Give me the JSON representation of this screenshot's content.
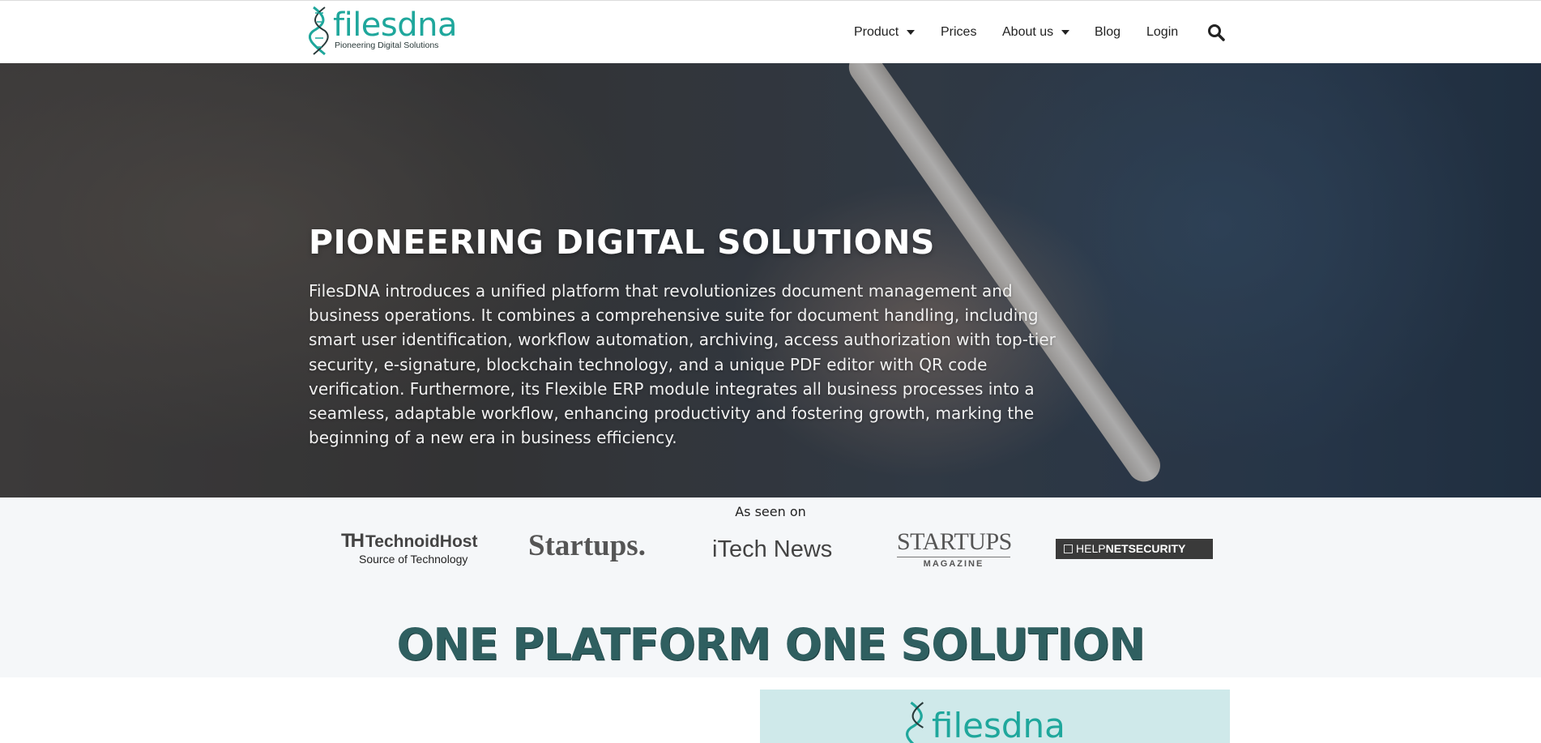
{
  "brand": {
    "name": "filesdna",
    "tagline": "Pioneering Digital Solutions",
    "color": "#1fa79c"
  },
  "nav": {
    "items": [
      {
        "label": "Product",
        "has_dropdown": true
      },
      {
        "label": "Prices",
        "has_dropdown": false
      },
      {
        "label": "About us",
        "has_dropdown": true
      },
      {
        "label": "Blog",
        "has_dropdown": false
      },
      {
        "label": "Login",
        "has_dropdown": false
      }
    ],
    "search_icon": "search-icon"
  },
  "hero": {
    "title": "PIONEERING DIGITAL SOLUTIONS",
    "text": "FilesDNA introduces a unified platform that revolutionizes document management and business operations. It combines a comprehensive suite for document handling, including smart user identification, workflow automation, archiving, access authorization with top-tier security, e-signature, blockchain technology, and a unique PDF editor with QR code verification. Furthermore, its Flexible ERP module integrates all business processes into a seamless, adaptable workflow, enhancing productivity and fostering growth, marking the beginning of a new era in business efficiency."
  },
  "press": {
    "label": "As seen on",
    "logos": {
      "technoid_name": "TechnoidHost",
      "technoid_tag": "Source of Technology",
      "startups": "Startups.",
      "itech": "iTech News",
      "startups_mag_1": "STARTUPS",
      "startups_mag_2": "MAGAZINE",
      "helpnet_1": "HELP",
      "helpnet_2": "NETSECURITY"
    }
  },
  "section": {
    "title": "ONE PLATFORM ONE SOLUTION",
    "color": "#2f5f60"
  },
  "preview": {
    "word": "filesdna"
  }
}
